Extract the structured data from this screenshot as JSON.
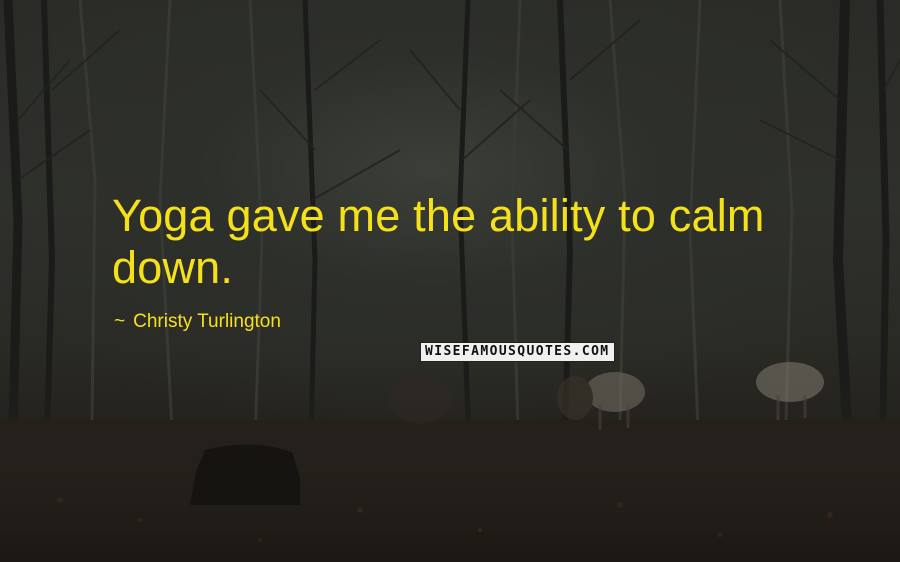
{
  "quote": {
    "text": "Yoga gave me the ability to calm down.",
    "author": "Christy Turlington",
    "dash": "~"
  },
  "watermark": "WISEFAMOUSQUOTES.COM",
  "colors": {
    "quote_text": "#f5e11a",
    "background": "#2b2c28",
    "ground": "#1c1814"
  }
}
